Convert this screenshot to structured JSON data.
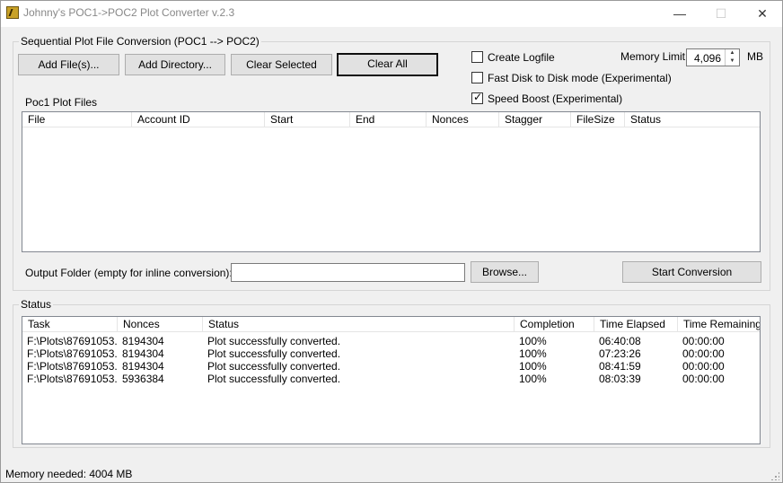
{
  "window": {
    "title": "Johnny's POC1->POC2 Plot Converter v.2.3",
    "minimize_glyph": "—",
    "maximize_glyph": "☐",
    "close_glyph": "✕"
  },
  "conversion_group": {
    "legend": "Sequential Plot File Conversion (POC1 --> POC2)",
    "buttons": {
      "add_files": "Add File(s)...",
      "add_directory": "Add Directory...",
      "clear_selected": "Clear Selected",
      "clear_all": "Clear All"
    },
    "options": {
      "create_logfile": {
        "label": "Create Logfile",
        "checked": false
      },
      "fast_disk": {
        "label": "Fast Disk to Disk mode (Experimental)",
        "checked": false
      },
      "speed_boost": {
        "label": "Speed Boost (Experimental)",
        "checked": true
      }
    },
    "memory_limit": {
      "label": "Memory Limit",
      "value": "4,096",
      "unit": "MB"
    },
    "files_label": "Poc1 Plot Files",
    "files_columns": [
      "File",
      "Account ID",
      "Start",
      "End",
      "Nonces",
      "Stagger",
      "FileSize",
      "Status"
    ],
    "files_rows": [],
    "output_label": "Output Folder (empty for inline conversion):",
    "output_value": "",
    "browse": "Browse...",
    "start": "Start Conversion"
  },
  "status_group": {
    "legend": "Status",
    "columns": [
      "Task",
      "Nonces",
      "Status",
      "Completion",
      "Time Elapsed",
      "Time Remaining"
    ],
    "rows": [
      [
        "F:\\Plots\\87691053...",
        "8194304",
        "Plot successfully converted.",
        "100%",
        "06:40:08",
        "00:00:00"
      ],
      [
        "F:\\Plots\\87691053...",
        "8194304",
        "Plot successfully converted.",
        "100%",
        "07:23:26",
        "00:00:00"
      ],
      [
        "F:\\Plots\\87691053...",
        "8194304",
        "Plot successfully converted.",
        "100%",
        "08:41:59",
        "00:00:00"
      ],
      [
        "F:\\Plots\\87691053...",
        "5936384",
        "Plot successfully converted.",
        "100%",
        "08:03:39",
        "00:00:00"
      ]
    ]
  },
  "statusbar": {
    "text": "Memory needed: 4004 MB"
  }
}
